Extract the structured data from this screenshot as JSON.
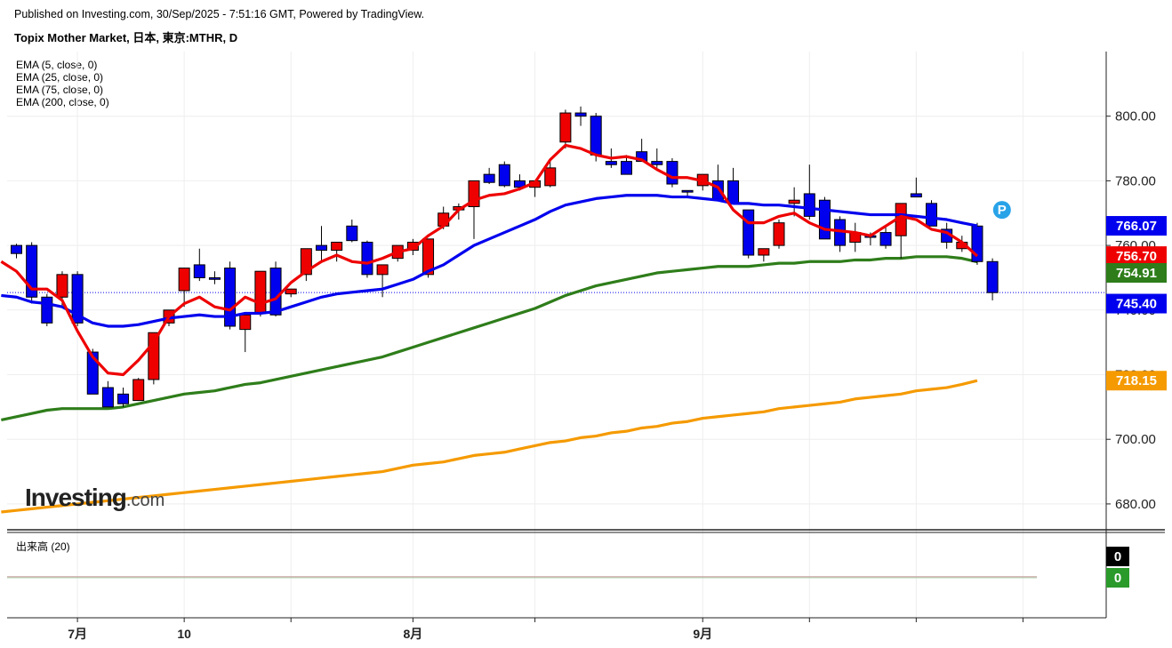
{
  "header": {
    "published": "Published on Investing.com, 30/Sep/2025 - 7:51:16 GMT, Powered by TradingView.",
    "title": "Topix Mother Market, 日本, 東京:MTHR, D"
  },
  "legend": [
    "EMA (5, close, 0)",
    "EMA (25, close, 0)",
    "EMA (75, close, 0)",
    "EMA (200, close, 0)"
  ],
  "volume_title": "出来高 (20)",
  "logo": {
    "text": "Investing",
    "suffix": ".com"
  },
  "colors": {
    "up": "#ee0000",
    "down": "#0000ee",
    "ema5": "#ee0000",
    "ema25": "#0000ee",
    "ema75": "#2e7d1a",
    "ema200": "#f59a00",
    "grid": "#eeeeee",
    "vol_up": "#2a9a2a"
  },
  "chart_data": {
    "type": "candlestick",
    "y_axis": {
      "ticks": [
        "680.00",
        "700.00",
        "720.00",
        "740.00",
        "760.00",
        "780.00",
        "800.00"
      ],
      "range": [
        672,
        820
      ]
    },
    "x_axis": {
      "labels": [
        {
          "text": "7月",
          "at": 4
        },
        {
          "text": "10",
          "at": 11
        },
        {
          "text": "8月",
          "at": 26
        },
        {
          "text": "9月",
          "at": 45
        }
      ]
    },
    "candles": [
      [
        760,
        760.5,
        756,
        757.5
      ],
      [
        760,
        761,
        742,
        744
      ],
      [
        744,
        745,
        735,
        736
      ],
      [
        744,
        752,
        741,
        751
      ],
      [
        751,
        752,
        735,
        736
      ],
      [
        727,
        728,
        714,
        714
      ],
      [
        716,
        718,
        710,
        710
      ],
      [
        714,
        716,
        710,
        711
      ],
      [
        712,
        719,
        712,
        718.5
      ],
      [
        718.5,
        733,
        717,
        733
      ],
      [
        736,
        740,
        735,
        740
      ],
      [
        746,
        753,
        741,
        753
      ],
      [
        754,
        759,
        749,
        750
      ],
      [
        750,
        752,
        748,
        749.5
      ],
      [
        753,
        755,
        734,
        735
      ],
      [
        734,
        739,
        727,
        738.5
      ],
      [
        739,
        752,
        738,
        752
      ],
      [
        753,
        755,
        738,
        738.5
      ],
      [
        745,
        746,
        744,
        746.5
      ],
      [
        751,
        759,
        749,
        759
      ],
      [
        760,
        766,
        755,
        758.5
      ],
      [
        758.5,
        761,
        755,
        761
      ],
      [
        766,
        768,
        761,
        761.5
      ],
      [
        761,
        761.5,
        750,
        751
      ],
      [
        751,
        753,
        744,
        754
      ],
      [
        756,
        760,
        755,
        760
      ],
      [
        758.5,
        762,
        757,
        761
      ],
      [
        751,
        761,
        750,
        762
      ],
      [
        766,
        772,
        765,
        770
      ],
      [
        771,
        773,
        768,
        772
      ],
      [
        772,
        773,
        762,
        780
      ],
      [
        782,
        784,
        779,
        779.5
      ],
      [
        785,
        786,
        778,
        778.5
      ],
      [
        780,
        782,
        777,
        778
      ],
      [
        778,
        778.5,
        775,
        780
      ],
      [
        778.5,
        787,
        778,
        784
      ],
      [
        792,
        802,
        790,
        801
      ],
      [
        801,
        803,
        797,
        800
      ],
      [
        800,
        801,
        786,
        788
      ],
      [
        786,
        790,
        784,
        785
      ],
      [
        786,
        788,
        782,
        782
      ],
      [
        789,
        793,
        786,
        786
      ],
      [
        786,
        790,
        784,
        785
      ],
      [
        786,
        787,
        778,
        779
      ],
      [
        777,
        776,
        775,
        776.5
      ],
      [
        778.5,
        782,
        777,
        782
      ],
      [
        780,
        785,
        774,
        774
      ],
      [
        780,
        784,
        773,
        773
      ],
      [
        771,
        771,
        756,
        757
      ],
      [
        757,
        759,
        755,
        759
      ],
      [
        760,
        768,
        759,
        767
      ],
      [
        773,
        778,
        769,
        774
      ],
      [
        776,
        785,
        768,
        769
      ],
      [
        774,
        775,
        762,
        762
      ],
      [
        768,
        769,
        758,
        760
      ],
      [
        761,
        767,
        758,
        764
      ],
      [
        763,
        764,
        760,
        762.5
      ],
      [
        764,
        766,
        759,
        760
      ],
      [
        763,
        773,
        756,
        773
      ],
      [
        776,
        781,
        775,
        775
      ],
      [
        773,
        774,
        766,
        766
      ],
      [
        765,
        767,
        759,
        761
      ],
      [
        759,
        763,
        758,
        761
      ],
      [
        766,
        767,
        754,
        755
      ],
      [
        755,
        756,
        743,
        745.4
      ]
    ],
    "series": [
      {
        "name": "EMA (5, close, 0)",
        "last": "756.70",
        "values": [
          755,
          752,
          746.5,
          746.5,
          743,
          733.5,
          725.5,
          720.5,
          720,
          724.5,
          730,
          738,
          742,
          744,
          741,
          740,
          744,
          742,
          743.5,
          748.5,
          752,
          755,
          757,
          755,
          754.5,
          756,
          758,
          759,
          763,
          766,
          771,
          774,
          775.5,
          776,
          777.5,
          779.5,
          786.5,
          791,
          790,
          788,
          787,
          787.5,
          786.5,
          783.5,
          781,
          781,
          780,
          778,
          771,
          767,
          767,
          769,
          770,
          767,
          765,
          764.5,
          764,
          763,
          766,
          769,
          768,
          765,
          764,
          761,
          756.7
        ]
      },
      {
        "name": "EMA (25, close, 0)",
        "last": "766.07",
        "values": [
          744.5,
          744,
          742.5,
          742,
          741,
          738.5,
          736,
          735,
          735,
          735.5,
          736.5,
          737.5,
          738,
          738.5,
          738,
          738,
          739,
          739,
          739.5,
          741,
          742.5,
          744,
          745,
          745.5,
          746,
          746.5,
          748,
          749.5,
          752,
          754,
          757,
          760,
          762,
          764,
          766,
          768,
          770.5,
          772.5,
          773.5,
          774.5,
          775,
          775.5,
          775.5,
          775.5,
          775,
          775,
          774.5,
          774,
          773,
          773,
          772.5,
          772.5,
          772,
          771.5,
          771,
          770.5,
          770,
          769.5,
          769.5,
          769.5,
          769,
          768.5,
          768,
          767,
          766.07
        ]
      },
      {
        "name": "EMA (75, close, 0)",
        "last": "754.91",
        "values": [
          706,
          707,
          708,
          709,
          709.5,
          709.5,
          709.5,
          709.5,
          710,
          711,
          712,
          713,
          714,
          714.5,
          715,
          716,
          717,
          717.5,
          718.5,
          719.5,
          720.5,
          721.5,
          722.5,
          723.5,
          724.5,
          725.5,
          727,
          728.5,
          730,
          731.5,
          733,
          734.5,
          736,
          737.5,
          739,
          740.5,
          742.5,
          744.5,
          746,
          747.5,
          748.5,
          749.5,
          750.5,
          751.5,
          752,
          752.5,
          753,
          753.5,
          753.5,
          753.5,
          754,
          754.5,
          754.5,
          755,
          755,
          755,
          755.5,
          755.5,
          756,
          756,
          756.5,
          756.5,
          756.5,
          756,
          754.91
        ]
      },
      {
        "name": "EMA (200, close, 0)",
        "last": "718.15",
        "values": [
          677.5,
          678,
          678.5,
          679,
          679.5,
          680,
          680.5,
          681,
          681.5,
          682,
          682.5,
          683,
          683.5,
          684,
          684.5,
          685,
          685.5,
          686,
          686.5,
          687,
          687.5,
          688,
          688.5,
          689,
          689.5,
          690,
          691,
          692,
          692.5,
          693,
          694,
          695,
          695.5,
          696,
          697,
          698,
          699,
          699.5,
          700.5,
          701,
          702,
          702.5,
          703.5,
          704,
          705,
          705.5,
          706.5,
          707,
          707.5,
          708,
          708.5,
          709.5,
          710,
          710.5,
          711,
          711.5,
          712.5,
          713,
          713.5,
          714,
          715,
          715.5,
          716,
          717,
          718.15
        ]
      }
    ],
    "last_price": "745.40",
    "volume": {
      "last_labels": [
        "0",
        "0"
      ]
    }
  }
}
